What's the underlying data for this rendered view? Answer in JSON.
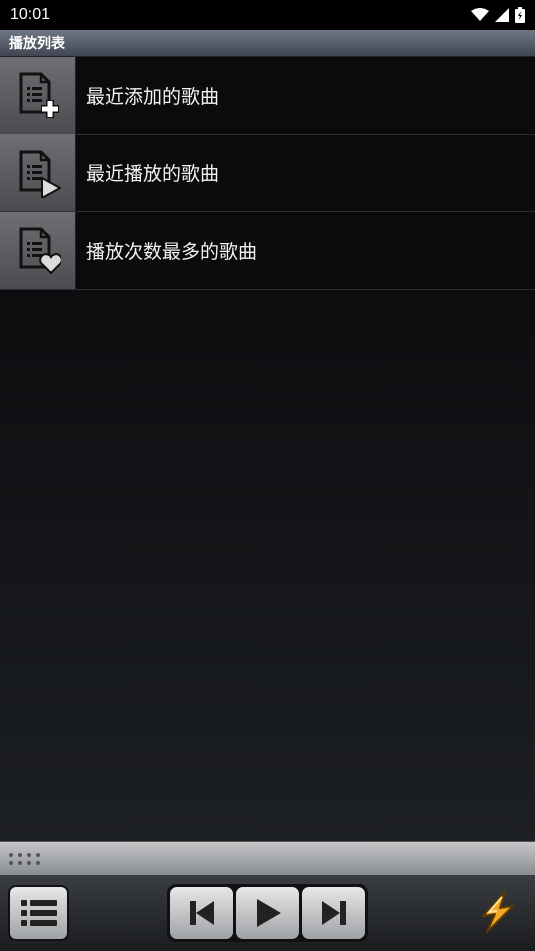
{
  "status_bar": {
    "time": "10:01",
    "icons": [
      "wifi-icon",
      "signal-icon",
      "battery-icon"
    ]
  },
  "header": {
    "title": "播放列表"
  },
  "playlists": [
    {
      "label": "最近添加的歌曲",
      "icon": "playlist-add-icon"
    },
    {
      "label": "最近播放的歌曲",
      "icon": "playlist-play-icon"
    },
    {
      "label": "播放次数最多的歌曲",
      "icon": "playlist-heart-icon"
    }
  ],
  "controls": {
    "playlist_button_icon": "list-icon",
    "prev_icon": "skip-previous-icon",
    "play_icon": "play-icon",
    "next_icon": "skip-next-icon",
    "bolt_icon": "lightning-bolt-icon"
  },
  "colors": {
    "accent_orange": "#f5a623",
    "header_gradient_top": "#6f7785",
    "list_background": "#0a0b0c"
  }
}
